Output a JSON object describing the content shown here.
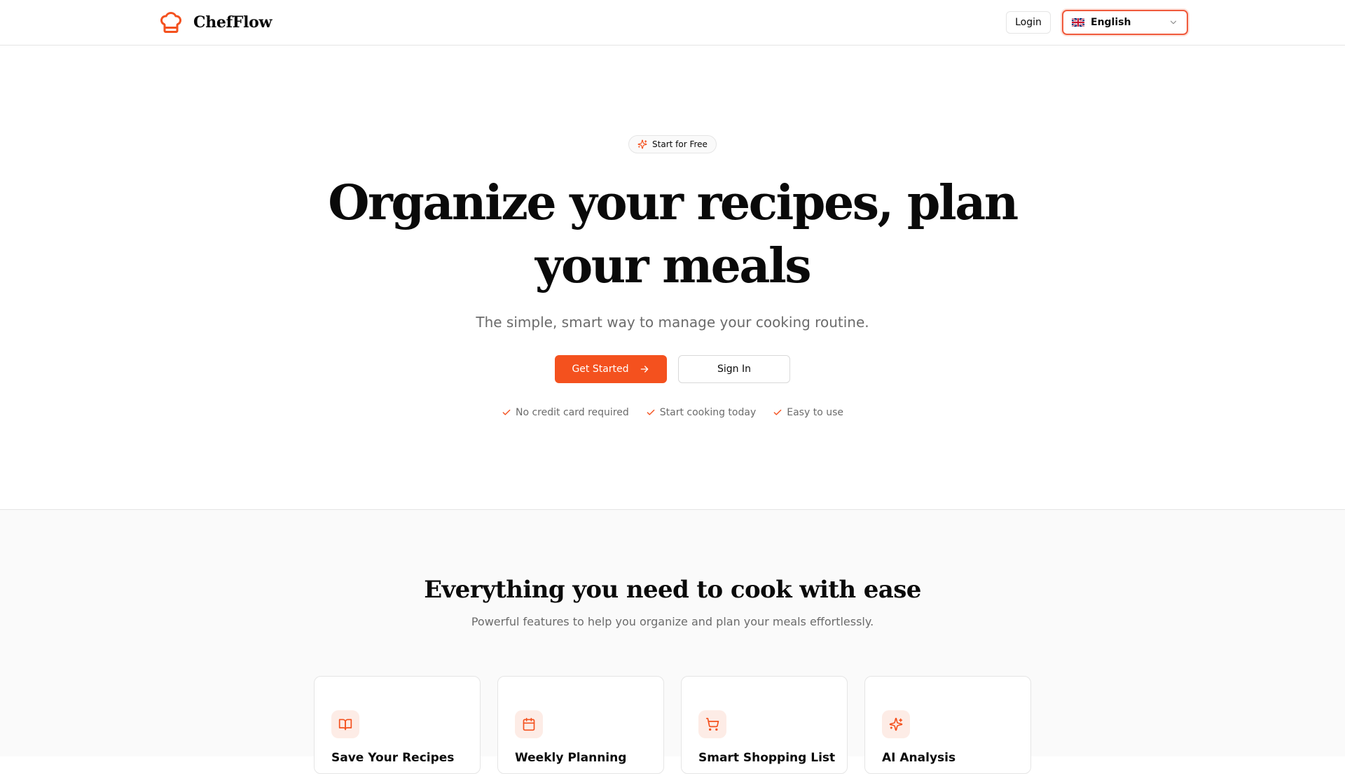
{
  "header": {
    "brand_name": "ChefFlow",
    "brand_icon": "chef-hat-icon",
    "login_label": "Login",
    "language": {
      "selected": "English",
      "flag_icon": "uk-flag-icon"
    }
  },
  "hero": {
    "badge_label": "Start for Free",
    "title": "Organize your recipes, plan your meals",
    "subtitle": "The simple, smart way to manage your cooking routine.",
    "primary_cta": "Get Started",
    "secondary_cta": "Sign In",
    "perks": [
      "No credit card required",
      "Start cooking today",
      "Easy to use"
    ]
  },
  "features": {
    "title": "Everything you need to cook with ease",
    "subtitle": "Powerful features to help you organize and plan your meals effortlessly.",
    "cards": [
      {
        "title": "Save Your Recipes",
        "icon": "book-open-icon"
      },
      {
        "title": "Weekly Planning",
        "icon": "calendar-icon"
      },
      {
        "title": "Smart Shopping List",
        "icon": "shopping-cart-icon"
      },
      {
        "title": "AI Analysis",
        "icon": "sparkles-icon"
      }
    ]
  },
  "colors": {
    "accent": "#f4511e",
    "accent_soft": "#fdece6",
    "text": "#0a0a0a",
    "muted": "#6b6b6b",
    "border": "#e5e5e5"
  }
}
